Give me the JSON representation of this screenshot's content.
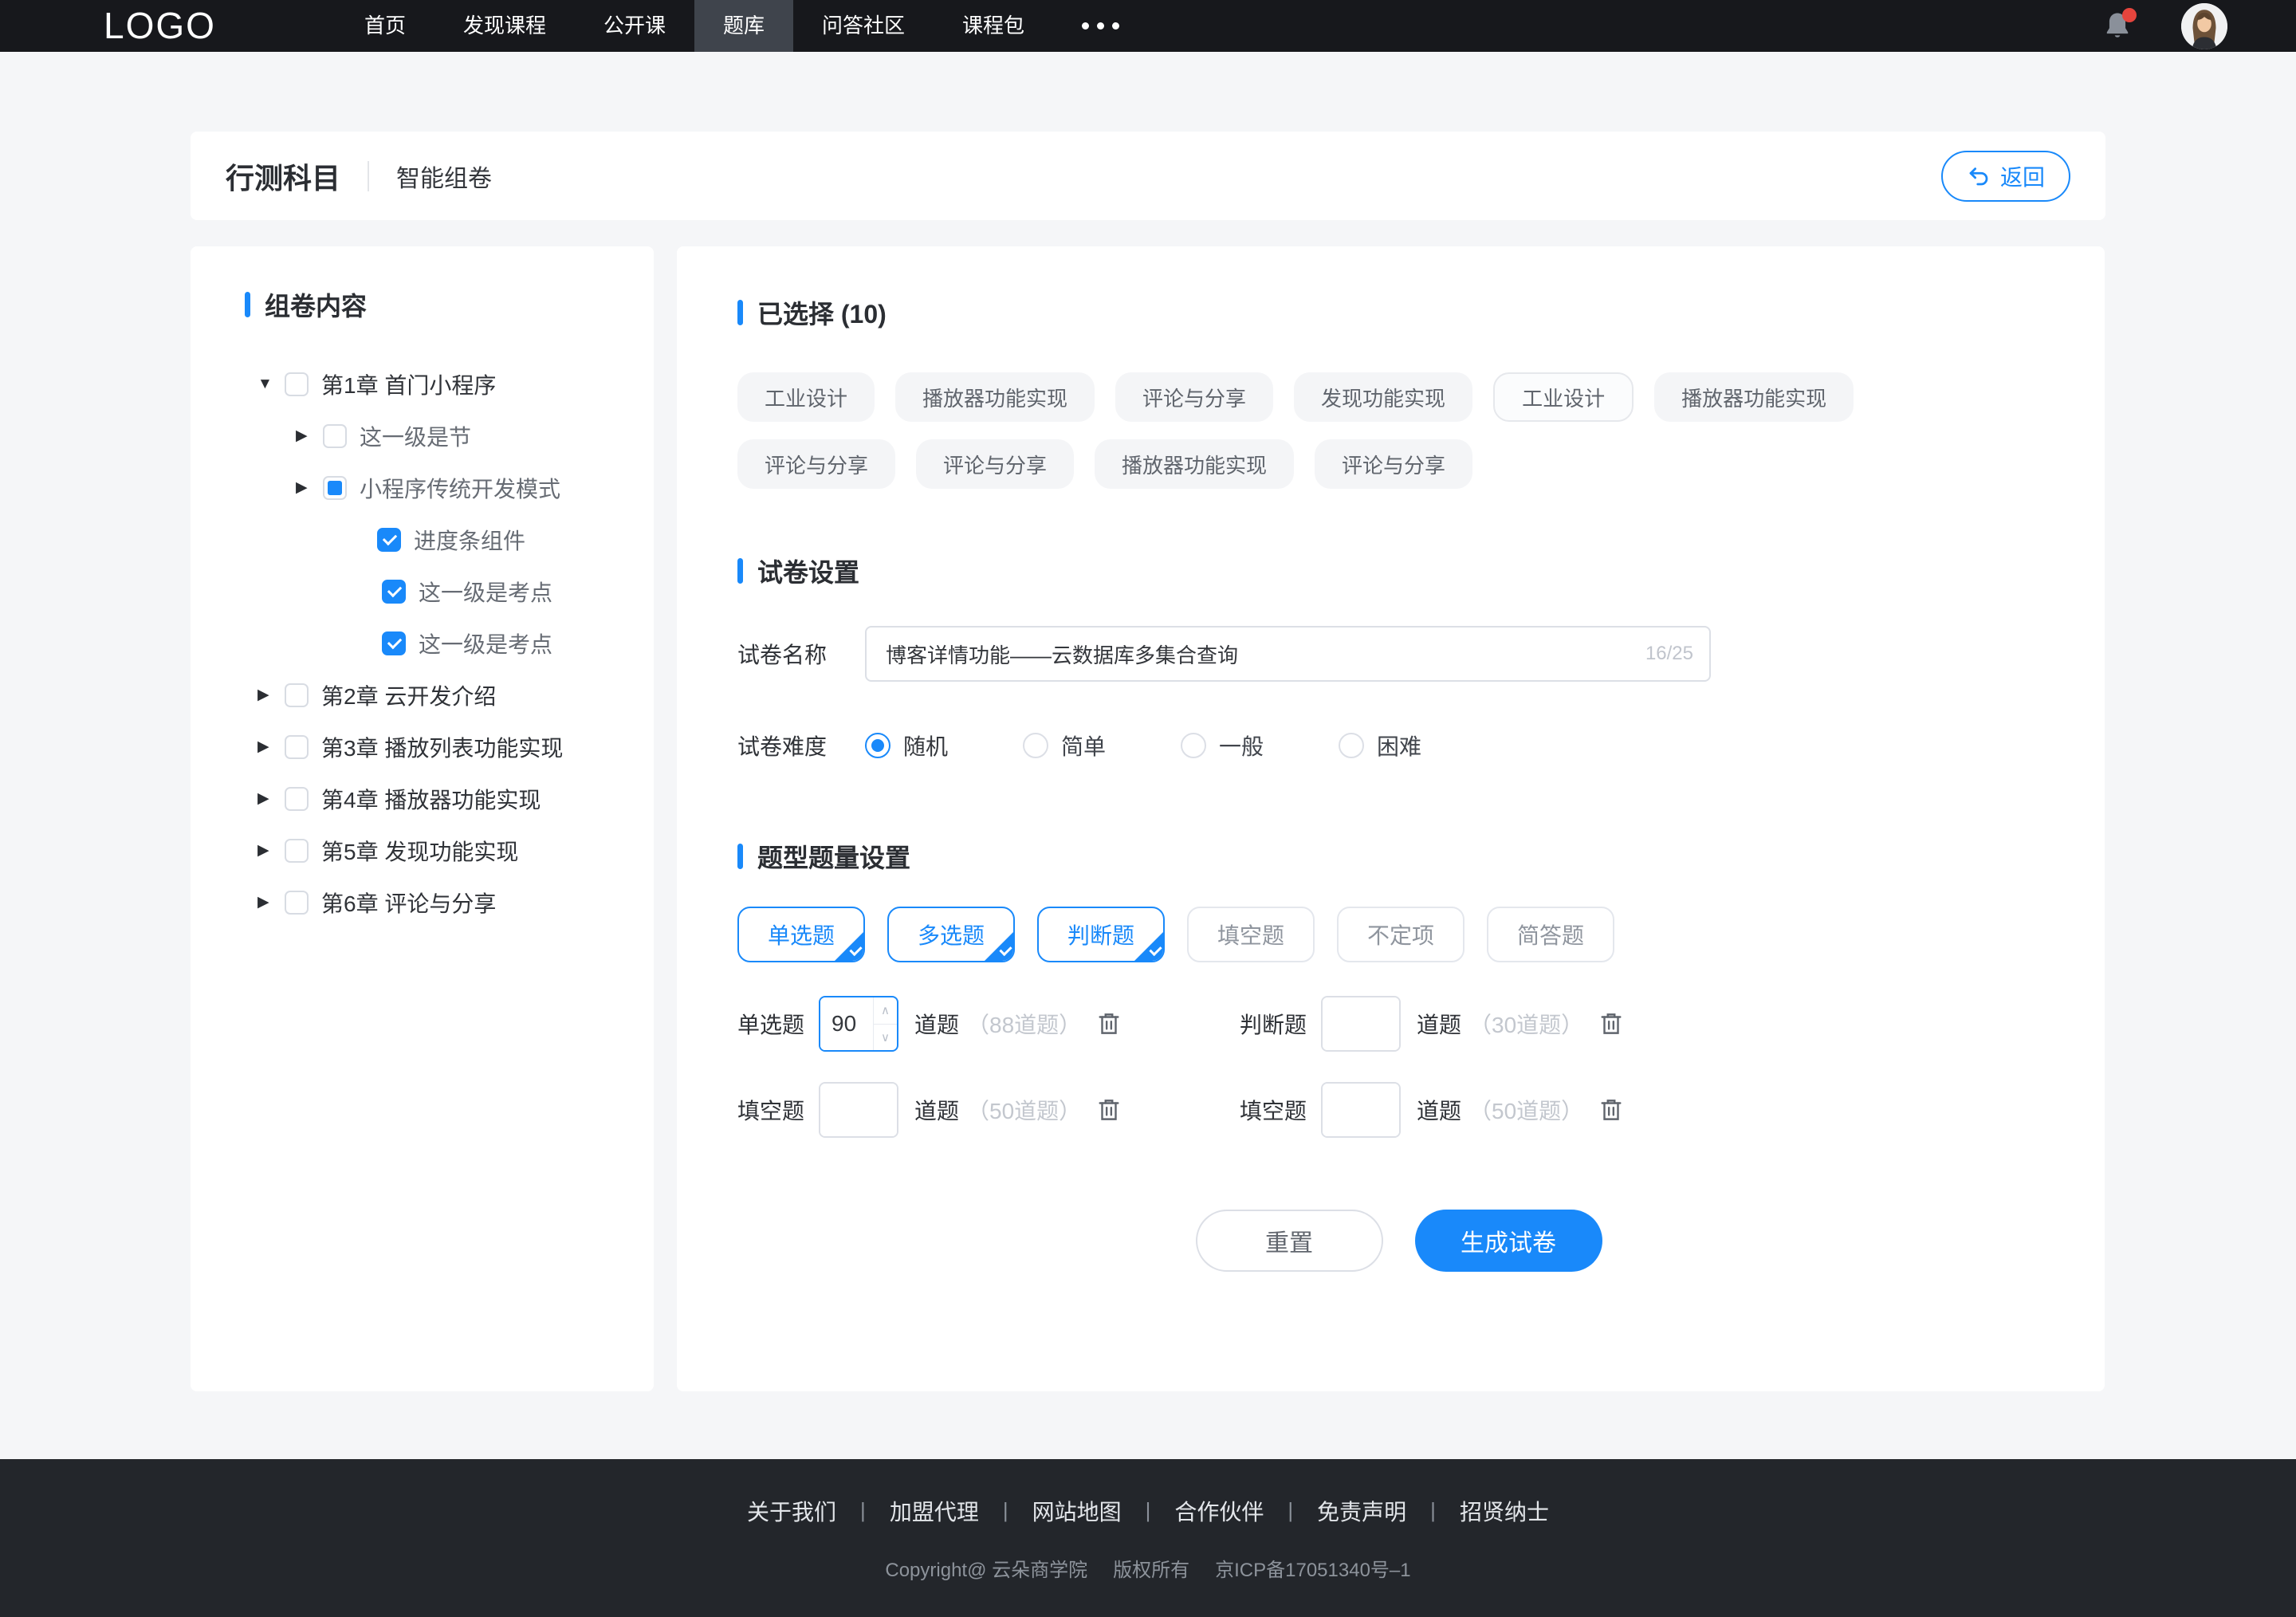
{
  "colors": {
    "accent_blue": "#1989fa",
    "nav_bg": "#17181c",
    "nav_active_bg": "#3f444c",
    "footer_bg": "#23262b",
    "page_bg": "#f5f6f8",
    "badge_red": "#e5453d",
    "tag_bg": "#f4f5f7",
    "border_gray": "#dcdfe6"
  },
  "icons": {
    "bell": "bell-icon",
    "more": "more-ellipsis-icon",
    "back": "undo-arrow-icon",
    "trash": "trash-icon",
    "arrow_expanded": "caret-down",
    "arrow_collapsed": "caret-right"
  },
  "nav": {
    "logo": "LOGO",
    "items": [
      {
        "label": "首页",
        "active": false
      },
      {
        "label": "发现课程",
        "active": false
      },
      {
        "label": "公开课",
        "active": false
      },
      {
        "label": "题库",
        "active": true
      },
      {
        "label": "问答社区",
        "active": false
      },
      {
        "label": "课程包",
        "active": false
      }
    ]
  },
  "header": {
    "title": "行测科目",
    "subtitle": "智能组卷",
    "back_label": "返回"
  },
  "sidebar": {
    "title": "组卷内容",
    "tree": [
      {
        "label": "第1章 首门小程序",
        "level": 1,
        "arrow": "expanded",
        "state": "unchecked"
      },
      {
        "label": "这一级是节",
        "level": 2,
        "arrow": "collapsed",
        "state": "unchecked"
      },
      {
        "label": "小程序传统开发模式",
        "level": 2,
        "arrow": "collapsed",
        "state": "indeterminate"
      },
      {
        "label": "进度条组件",
        "level": 3,
        "arrow": "none",
        "state": "checked"
      },
      {
        "label": "这一级是考点",
        "level": 4,
        "arrow": "none",
        "state": "checked"
      },
      {
        "label": "这一级是考点",
        "level": 4,
        "arrow": "none",
        "state": "checked"
      },
      {
        "label": "第2章 云开发介绍",
        "level": 1,
        "arrow": "collapsed",
        "state": "unchecked"
      },
      {
        "label": "第3章 播放列表功能实现",
        "level": 1,
        "arrow": "collapsed",
        "state": "unchecked"
      },
      {
        "label": "第4章 播放器功能实现",
        "level": 1,
        "arrow": "collapsed",
        "state": "unchecked"
      },
      {
        "label": "第5章 发现功能实现",
        "level": 1,
        "arrow": "collapsed",
        "state": "unchecked"
      },
      {
        "label": "第6章 评论与分享",
        "level": 1,
        "arrow": "collapsed",
        "state": "unchecked"
      }
    ]
  },
  "selected": {
    "title": "已选择 (10)",
    "tags": [
      "工业设计",
      "播放器功能实现",
      "评论与分享",
      "发现功能实现",
      "工业设计",
      "播放器功能实现",
      "评论与分享",
      "评论与分享",
      "播放器功能实现",
      "评论与分享"
    ]
  },
  "paper_settings": {
    "title": "试卷设置",
    "name_label": "试卷名称",
    "name_value": "博客详情功能——云数据库多集合查询",
    "name_counter": "16/25",
    "difficulty_label": "试卷难度",
    "difficulty_options": [
      {
        "label": "随机",
        "selected": true
      },
      {
        "label": "简单",
        "selected": false
      },
      {
        "label": "一般",
        "selected": false
      },
      {
        "label": "困难",
        "selected": false
      }
    ]
  },
  "question_settings": {
    "title": "题型题量设置",
    "types": [
      {
        "label": "单选题",
        "selected": true
      },
      {
        "label": "多选题",
        "selected": true
      },
      {
        "label": "判断题",
        "selected": true
      },
      {
        "label": "填空题",
        "selected": false
      },
      {
        "label": "不定项",
        "selected": false
      },
      {
        "label": "简答题",
        "selected": false
      }
    ],
    "rows": [
      {
        "label": "单选题",
        "value": "90",
        "unit": "道题",
        "hint": "（88道题）"
      },
      {
        "label": "判断题",
        "value": "",
        "unit": "道题",
        "hint": "（30道题）"
      },
      {
        "label": "填空题",
        "value": "",
        "unit": "道题",
        "hint": "（50道题）"
      },
      {
        "label": "填空题",
        "value": "",
        "unit": "道题",
        "hint": "（50道题）"
      }
    ],
    "reset_label": "重置",
    "generate_label": "生成试卷"
  },
  "footer": {
    "links": [
      "关于我们",
      "加盟代理",
      "网站地图",
      "合作伙伴",
      "免责声明",
      "招贤纳士"
    ],
    "copyright": [
      "Copyright@ 云朵商学院",
      "版权所有",
      "京ICP备17051340号–1"
    ]
  }
}
